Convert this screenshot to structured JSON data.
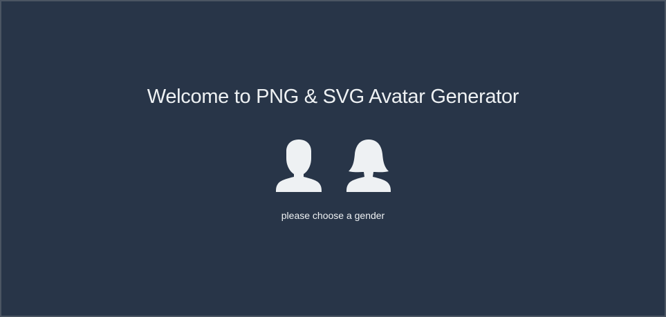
{
  "page": {
    "title": "Welcome to PNG & SVG Avatar Generator",
    "subtitle": "please choose a gender"
  },
  "genders": [
    {
      "id": "male",
      "icon": "male-user-icon"
    },
    {
      "id": "female",
      "icon": "female-user-icon"
    }
  ],
  "colors": {
    "background": "#283548",
    "foreground": "#eef1f3"
  }
}
